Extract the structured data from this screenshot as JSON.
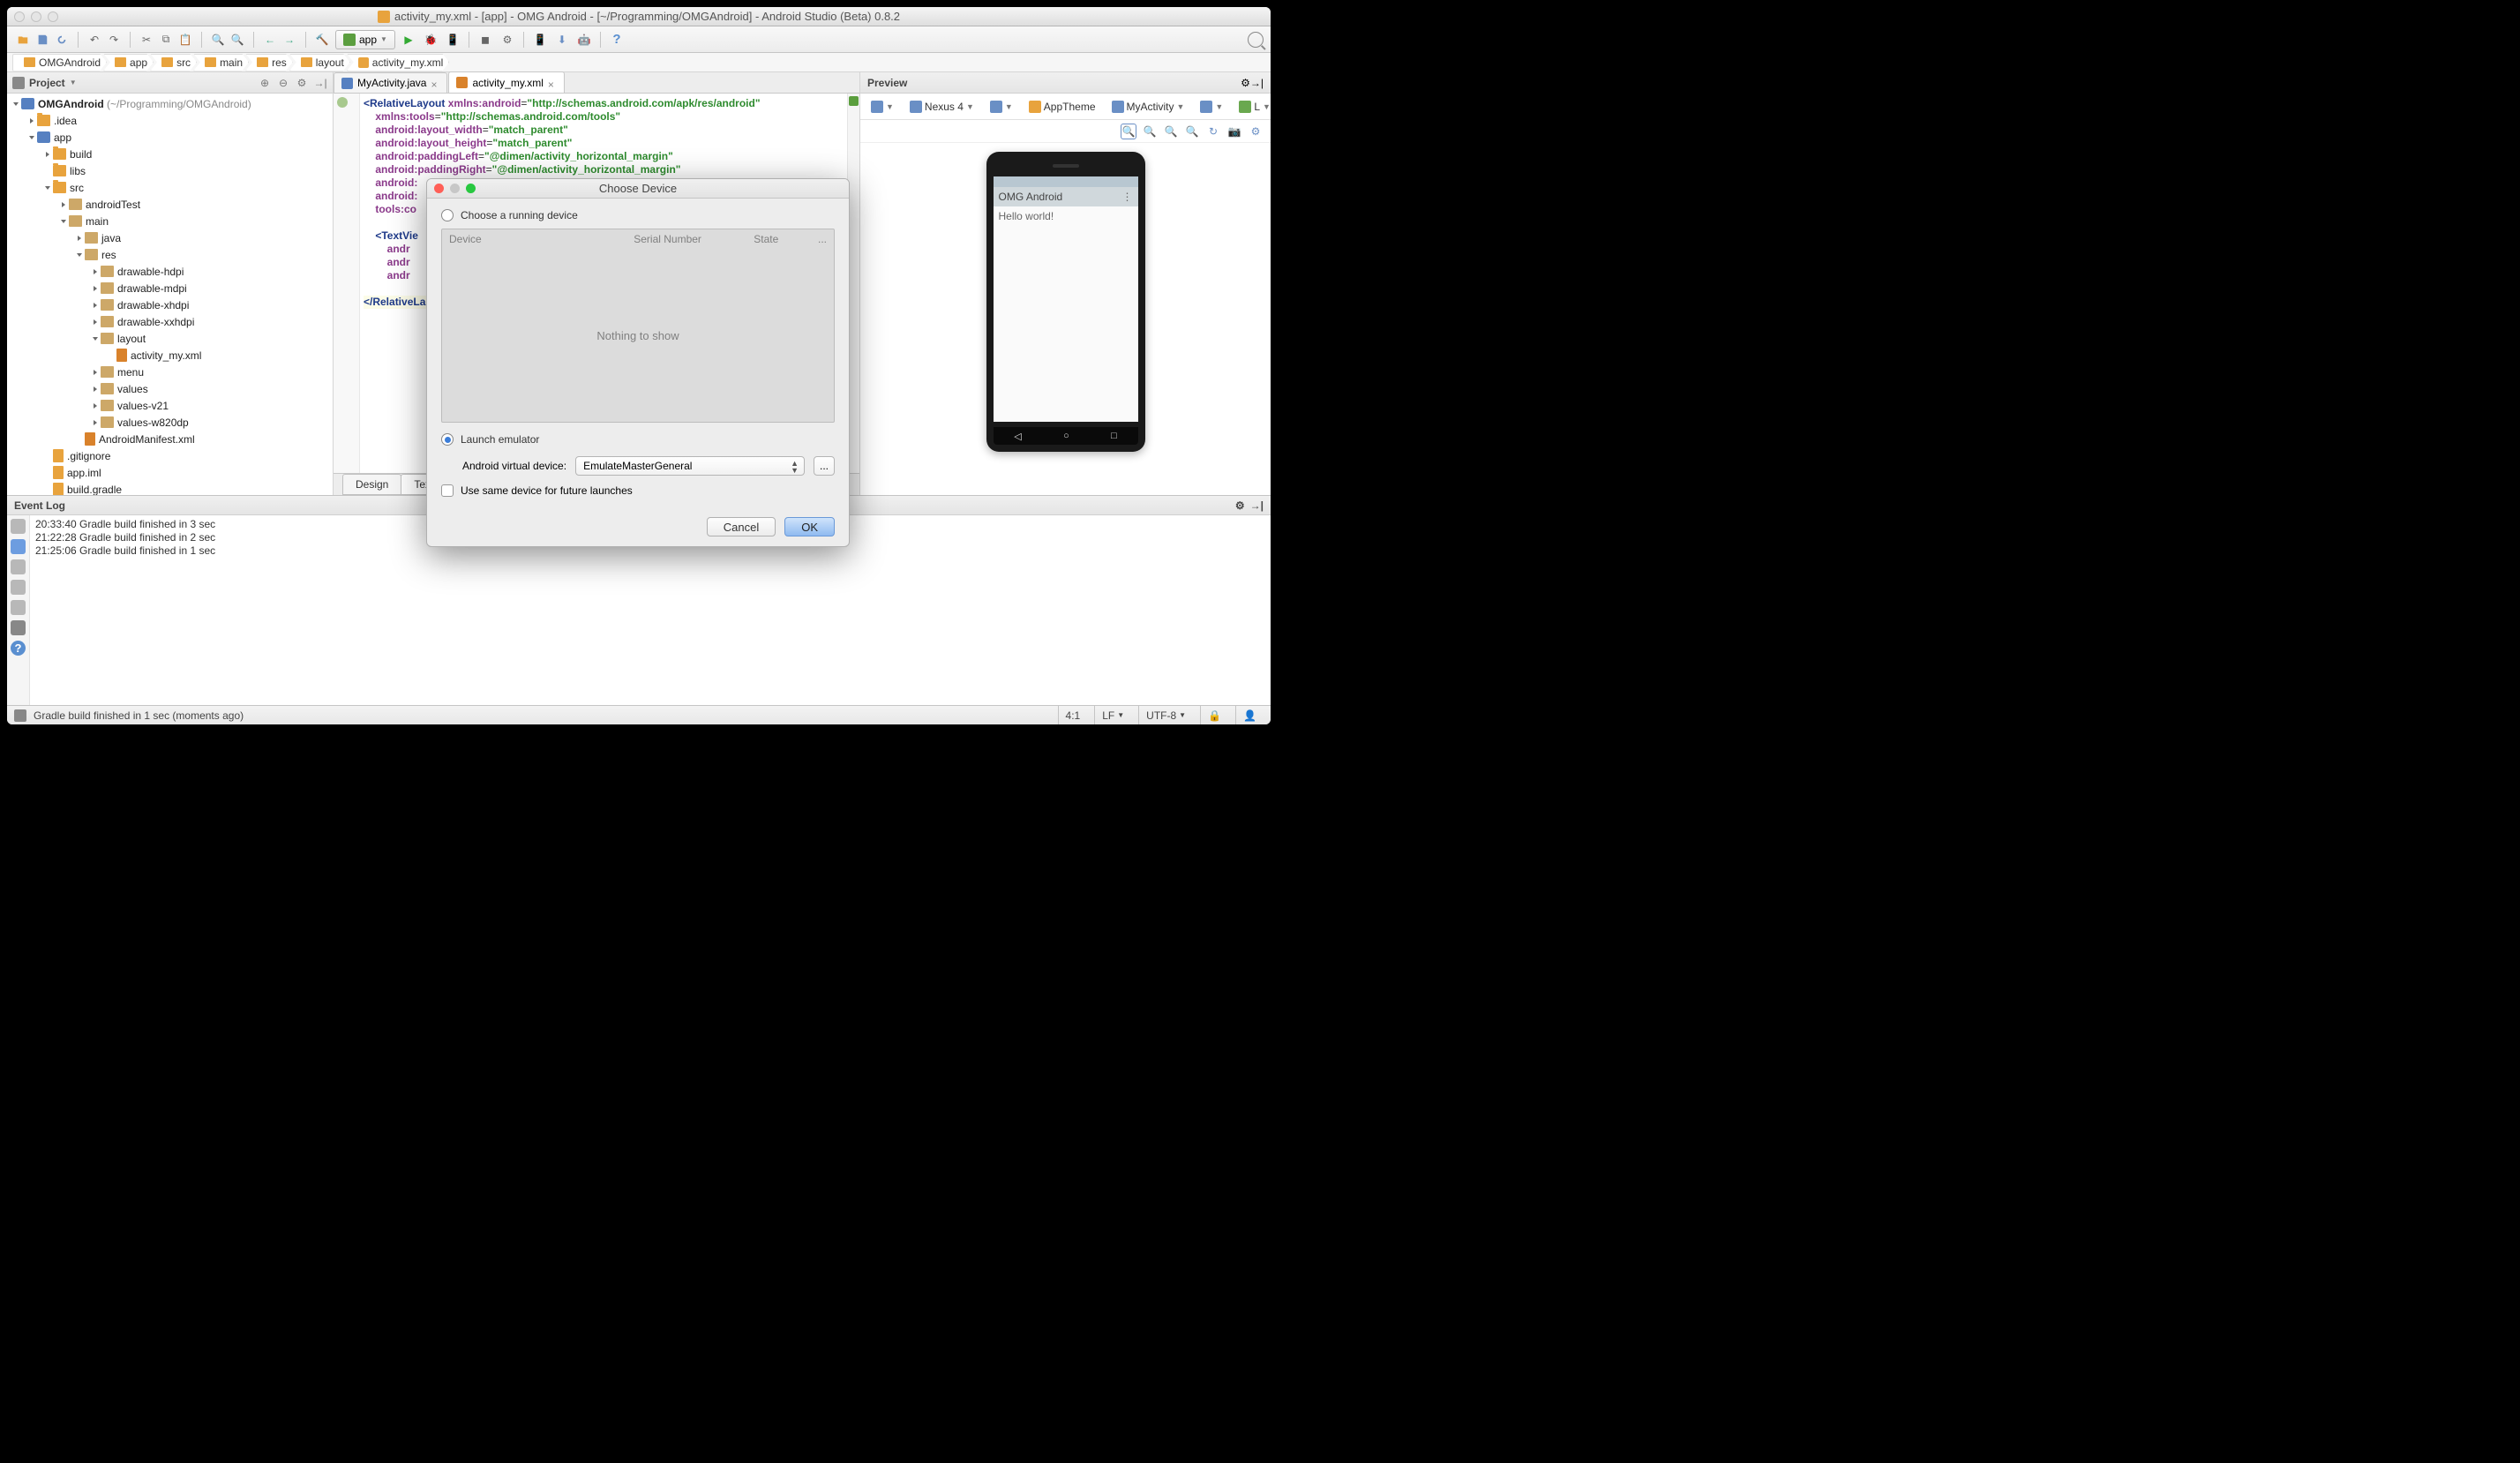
{
  "window": {
    "title": "activity_my.xml - [app] - OMG Android - [~/Programming/OMGAndroid] - Android Studio (Beta) 0.8.2"
  },
  "toolbar": {
    "app_selector": "app"
  },
  "breadcrumb": [
    "OMGAndroid",
    "app",
    "src",
    "main",
    "res",
    "layout",
    "activity_my.xml"
  ],
  "project_panel": {
    "title": "Project",
    "root": {
      "label": "OMGAndroid",
      "path": "(~/Programming/OMGAndroid)"
    },
    "nodes": [
      {
        "d": 1,
        "t": "closed",
        "i": "folder",
        "l": ".idea"
      },
      {
        "d": 1,
        "t": "open",
        "i": "mod",
        "l": "app"
      },
      {
        "d": 2,
        "t": "closed",
        "i": "folder",
        "l": "build"
      },
      {
        "d": 2,
        "t": "leaf",
        "i": "folder",
        "l": "libs"
      },
      {
        "d": 2,
        "t": "open",
        "i": "folder",
        "l": "src"
      },
      {
        "d": 3,
        "t": "closed",
        "i": "pkg",
        "l": "androidTest"
      },
      {
        "d": 3,
        "t": "open",
        "i": "pkg",
        "l": "main"
      },
      {
        "d": 4,
        "t": "closed",
        "i": "pkg",
        "l": "java"
      },
      {
        "d": 4,
        "t": "open",
        "i": "pkg",
        "l": "res"
      },
      {
        "d": 5,
        "t": "closed",
        "i": "pkg",
        "l": "drawable-hdpi"
      },
      {
        "d": 5,
        "t": "closed",
        "i": "pkg",
        "l": "drawable-mdpi"
      },
      {
        "d": 5,
        "t": "closed",
        "i": "pkg",
        "l": "drawable-xhdpi"
      },
      {
        "d": 5,
        "t": "closed",
        "i": "pkg",
        "l": "drawable-xxhdpi"
      },
      {
        "d": 5,
        "t": "open",
        "i": "pkg",
        "l": "layout"
      },
      {
        "d": 6,
        "t": "leaf",
        "i": "xml",
        "l": "activity_my.xml"
      },
      {
        "d": 5,
        "t": "closed",
        "i": "pkg",
        "l": "menu"
      },
      {
        "d": 5,
        "t": "closed",
        "i": "pkg",
        "l": "values"
      },
      {
        "d": 5,
        "t": "closed",
        "i": "pkg",
        "l": "values-v21"
      },
      {
        "d": 5,
        "t": "closed",
        "i": "pkg",
        "l": "values-w820dp"
      },
      {
        "d": 4,
        "t": "leaf",
        "i": "xml",
        "l": "AndroidManifest.xml"
      },
      {
        "d": 2,
        "t": "leaf",
        "i": "file",
        "l": ".gitignore"
      },
      {
        "d": 2,
        "t": "leaf",
        "i": "file",
        "l": "app.iml"
      },
      {
        "d": 2,
        "t": "leaf",
        "i": "file",
        "l": "build.gradle"
      }
    ]
  },
  "editor": {
    "tabs": [
      {
        "label": "MyActivity.java",
        "icon": "java",
        "active": false
      },
      {
        "label": "activity_my.xml",
        "icon": "xml",
        "active": true
      }
    ],
    "code_lines": [
      {
        "text": "<RelativeLayout ",
        "a1": "xmlns:android",
        "v1": "\"http://schemas.android.com/apk/res/android\""
      },
      {
        "indent": "    ",
        "a1": "xmlns:tools",
        "v1": "\"http://schemas.android.com/tools\""
      },
      {
        "indent": "    ",
        "a1": "android:layout_width",
        "v1": "\"match_parent\""
      },
      {
        "indent": "    ",
        "a1": "android:layout_height",
        "v1": "\"match_parent\""
      },
      {
        "indent": "    ",
        "a1": "android:paddingLeft",
        "v1": "\"@dimen/activity_horizontal_margin\""
      },
      {
        "indent": "    ",
        "a1": "android:paddingRight",
        "v1": "\"@dimen/activity_horizontal_margin\""
      },
      {
        "indent": "    ",
        "a1": "android:",
        "v1": ""
      },
      {
        "indent": "    ",
        "a1": "android:",
        "v1": ""
      },
      {
        "indent": "    ",
        "a1": "tools:co",
        "v1": ""
      },
      {
        "blank": true
      },
      {
        "indent": "    ",
        "tag": "<TextVie"
      },
      {
        "indent": "        ",
        "a1": "andr",
        "v1": ""
      },
      {
        "indent": "        ",
        "a1": "andr",
        "v1": ""
      },
      {
        "indent": "        ",
        "a1": "andr",
        "v1": ""
      },
      {
        "blank": true
      },
      {
        "close": "</RelativeLa",
        "hl": true
      }
    ],
    "bottom_tabs": [
      "Design",
      "Text"
    ]
  },
  "preview": {
    "title": "Preview",
    "device": "Nexus 4",
    "theme": "AppTheme",
    "activity": "MyActivity",
    "locale": "L",
    "app_title": "OMG Android",
    "sample_text": "Hello world!"
  },
  "dialog": {
    "title": "Choose Device",
    "option_running": "Choose a running device",
    "option_launch": "Launch emulator",
    "table_headers": {
      "device": "Device",
      "serial": "Serial Number",
      "state": "State",
      "more": "..."
    },
    "empty_text": "Nothing to show",
    "avd_label": "Android virtual device:",
    "avd_value": "EmulateMasterGeneral",
    "avd_more": "...",
    "reuse_label": "Use same device for future launches",
    "cancel": "Cancel",
    "ok": "OK"
  },
  "event_log": {
    "title": "Event Log",
    "lines": [
      "20:33:40 Gradle build finished in 3 sec",
      "21:22:28 Gradle build finished in 2 sec",
      "21:25:06 Gradle build finished in 1 sec"
    ]
  },
  "statusbar": {
    "message": "Gradle build finished in 1 sec (moments ago)",
    "pos": "4:1",
    "lf": "LF",
    "enc": "UTF-8"
  }
}
